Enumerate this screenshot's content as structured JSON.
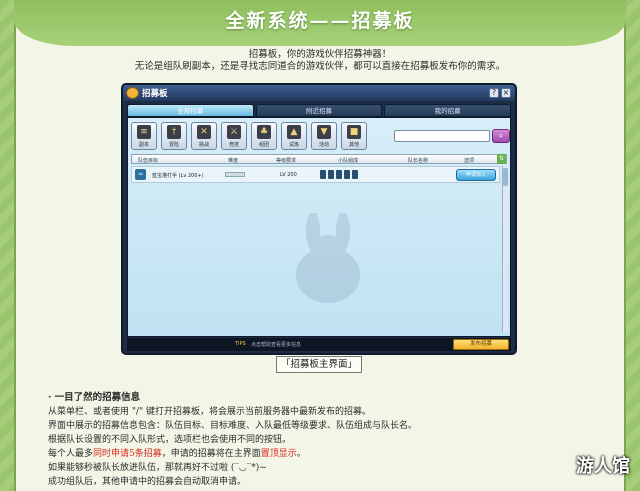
{
  "page": {
    "title": "全新系统——招募板",
    "intro_line1": "招募板，你的游戏伙伴招募神器！",
    "intro_line2": "无论是组队刷副本，还是寻找志同道合的游戏伙伴，都可以直接在招募板发布你的需求。",
    "caption": "「招募板主界面」",
    "section_title": "· 一目了然的招募信息",
    "paragraphs": [
      "从菜单栏、或者使用 \"/\" 键打开招募板，将会展示当前服务器中最新发布的招募。",
      "界面中展示的招募信息包含：队伍目标、目标难度、入队最低等级要求、队伍组成与队长名。",
      "根据队长设置的不同入队形式，选项栏也会使用不同的按钮。"
    ],
    "p4_a": "每个人最多",
    "p4_b": "同时申请5条招募",
    "p4_c": "，申请的招募将在主界面",
    "p4_d": "置顶显示",
    "p4_e": "。",
    "p5": "如果能够秒被队长放进队伍，那就再好不过啦 (‾◡‾*)~",
    "p6": "成功组队后，其他申请中的招募会自动取消申请。",
    "watermark": "游人馆"
  },
  "window": {
    "title": "招募板",
    "help_glyph": "?",
    "close_glyph": "×",
    "tabs": [
      "全部招募",
      "附近招募",
      "我的招募"
    ],
    "categories": [
      {
        "label": "副本",
        "icon": "scroll-icon",
        "glyph": "≡"
      },
      {
        "label": "冒险",
        "icon": "sword-icon",
        "glyph": "†"
      },
      {
        "label": "挑战",
        "icon": "crossed-swords-icon",
        "glyph": "✕"
      },
      {
        "label": "竞技",
        "icon": "duel-icon",
        "glyph": "⚔"
      },
      {
        "label": "组团",
        "icon": "group-icon",
        "glyph": "♣"
      },
      {
        "label": "试炼",
        "icon": "hat-icon",
        "glyph": "▲"
      },
      {
        "label": "活动",
        "icon": "badge-icon",
        "glyph": "▼"
      },
      {
        "label": "其他",
        "icon": "chest-icon",
        "glyph": "■"
      }
    ],
    "search_glyph": "⌕",
    "columns": [
      "队伍目标",
      "难度",
      "等级要求",
      "小队组成",
      "队长名称",
      "选项"
    ],
    "sort_glyph": "⇅",
    "row": {
      "name": "蓝宝港打手 (Lv 200+)",
      "level": "LV 200",
      "action": "申请加入",
      "icon_glyph": "≈"
    },
    "status": {
      "tip_label": "TIPS",
      "tip_text": "点击帮助查看更多信息",
      "publish_button": "发布招募"
    }
  }
}
